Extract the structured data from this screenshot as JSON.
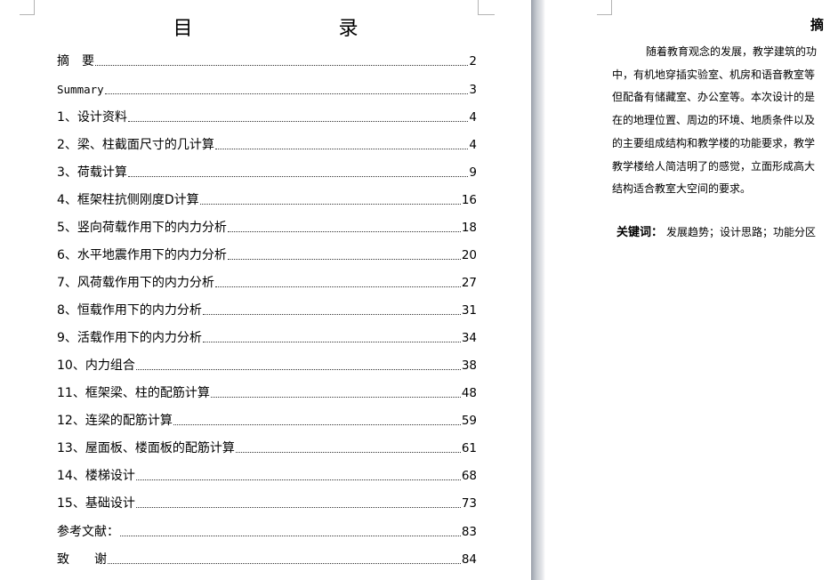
{
  "toc": {
    "title": "目　　录",
    "entries": [
      {
        "label": "摘　要",
        "page": "2"
      },
      {
        "label": "Summary",
        "page": "3",
        "mono": true
      },
      {
        "label": "1、设计资料",
        "page": "4"
      },
      {
        "label": "2、梁、柱截面尺寸的几计算",
        "page": "4"
      },
      {
        "label": "3、荷载计算",
        "page": "9"
      },
      {
        "label": "4、框架柱抗侧刚度D计算",
        "page": "16"
      },
      {
        "label": "5、竖向荷载作用下的内力分析",
        "page": "18"
      },
      {
        "label": "6、水平地震作用下的内力分析",
        "page": "20"
      },
      {
        "label": "7、风荷载作用下的内力分析",
        "page": "27"
      },
      {
        "label": "8、恒载作用下的内力分析",
        "page": "31"
      },
      {
        "label": "9、活载作用下的内力分析",
        "page": "34"
      },
      {
        "label": "10、内力组合",
        "page": "38"
      },
      {
        "label": "11、框架梁、柱的配筋计算",
        "page": "48"
      },
      {
        "label": "12、连梁的配筋计算",
        "page": "59"
      },
      {
        "label": "13、屋面板、楼面板的配筋计算",
        "page": "61"
      },
      {
        "label": "14、楼梯设计",
        "page": "68"
      },
      {
        "label": "15、基础设计",
        "page": "73"
      },
      {
        "label": "参考文献：",
        "page": "83"
      },
      {
        "label": "致　　谢",
        "page": "84"
      }
    ]
  },
  "abstract": {
    "title": "摘",
    "lines": [
      "随着教育观念的发展，教学建筑的功",
      "中，有机地穿插实验室、机房和语音教室等",
      "但配备有储藏室、办公室等。本次设计的是",
      "在的地理位置、周边的环境、地质条件以及",
      "的主要组成结构和教学楼的功能要求，教学",
      "教学楼给人简洁明了的感觉，立面形成高大",
      "结构适合教室大空间的要求。"
    ],
    "keywords_label": "关键词：",
    "keywords": "发展趋势；设计思路；功能分区"
  }
}
